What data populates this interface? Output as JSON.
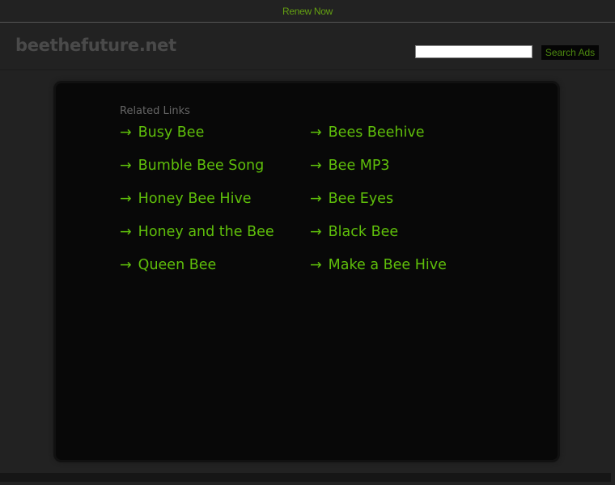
{
  "topbar": {
    "renew_label": "Renew Now"
  },
  "header": {
    "logo": "beethefuture.net",
    "search_value": "",
    "search_button": "Search Ads"
  },
  "related": {
    "title": "Related Links",
    "arrow": "→",
    "links": [
      "Busy Bee",
      "Bees Beehive",
      "Bumble Bee Song",
      "Bee MP3",
      "Honey Bee Hive",
      "Bee Eyes",
      "Honey and the Bee",
      "Black Bee",
      "Queen Bee",
      "Make a Bee Hive"
    ]
  },
  "colors": {
    "accent": "#5fbf0a",
    "background": "#222222",
    "panel": "#080808"
  }
}
